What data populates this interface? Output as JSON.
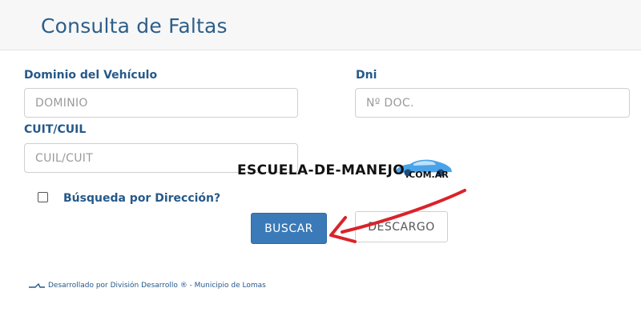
{
  "header": {
    "title": "Consulta de Faltas"
  },
  "form": {
    "dominio": {
      "label": "Dominio del Vehículo",
      "placeholder": "DOMINIO",
      "value": ""
    },
    "dni": {
      "label": "Dni",
      "placeholder": "Nº DOC.",
      "value": ""
    },
    "cuit": {
      "label": "CUIT/CUIL",
      "placeholder": "CUIL/CUIT",
      "value": ""
    },
    "checkbox": {
      "label": "Búsqueda por Dirección?",
      "checked": false
    }
  },
  "buttons": {
    "buscar": "BUSCAR",
    "descargo": "DESCARGO"
  },
  "footer": {
    "text": "Desarrollado por División Desarrollo ® - Municipio de Lomas"
  },
  "watermark": {
    "text": "ESCUELA-DE-MANEJO",
    "sub": ".COM.AR"
  },
  "colors": {
    "accent": "#3a7ab8",
    "label": "#25598a",
    "title": "#2c5f8a",
    "annotation_arrow": "#d9232a",
    "watermark_car": "#4aa3e8"
  },
  "icons": {
    "footer_logo": "municipio-logo-icon",
    "watermark_car": "car-icon",
    "annotation": "red-arrow-icon"
  }
}
